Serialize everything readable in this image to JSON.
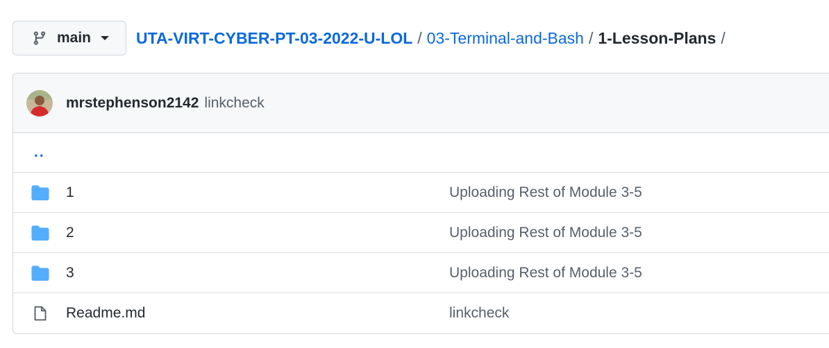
{
  "branch": {
    "label": "main",
    "icon": "git-branch-icon"
  },
  "breadcrumb": {
    "repo": "UTA-VIRT-CYBER-PT-03-2022-U-LOL",
    "folder": "03-Terminal-and-Bash",
    "current": "1-Lesson-Plans",
    "separator": "/"
  },
  "commit": {
    "author": "mrstephenson2142",
    "message": "linkcheck"
  },
  "files": {
    "up": "..",
    "items": [
      {
        "name": "1",
        "type": "folder",
        "icon": "folder-icon",
        "message": "Uploading Rest of Module 3-5"
      },
      {
        "name": "2",
        "type": "folder",
        "icon": "folder-icon",
        "message": "Uploading Rest of Module 3-5"
      },
      {
        "name": "3",
        "type": "folder",
        "icon": "folder-icon",
        "message": "Uploading Rest of Module 3-5"
      },
      {
        "name": "Readme.md",
        "type": "file",
        "icon": "file-icon",
        "message": "linkcheck"
      }
    ]
  },
  "colors": {
    "link": "#0969da",
    "folder": "#54aeff",
    "muted": "#57606a",
    "border": "#d0d7de"
  }
}
